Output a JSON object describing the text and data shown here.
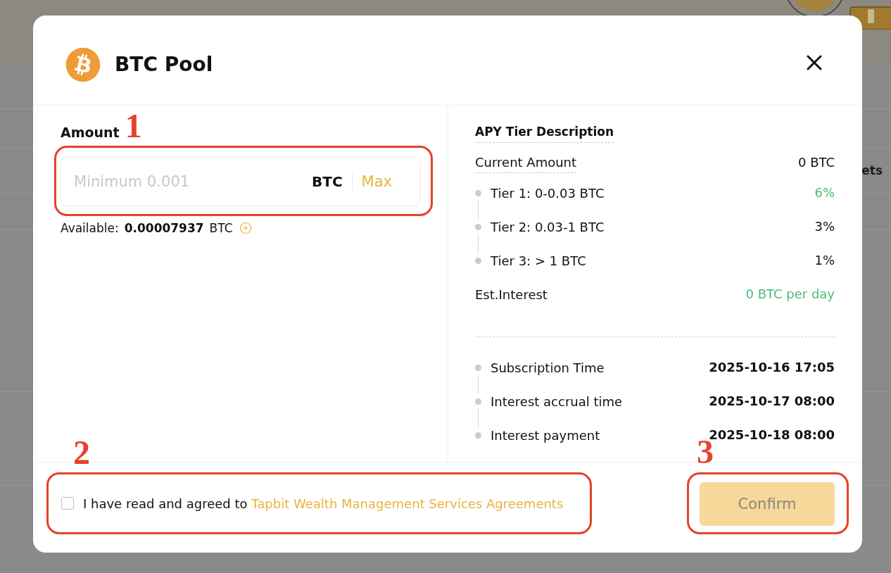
{
  "background_page": {
    "partial_text": "ets"
  },
  "dialog": {
    "title": "BTC Pool",
    "amount": {
      "label": "Amount",
      "annotation": "1",
      "placeholder": "Minimum 0.001",
      "unit": "BTC",
      "max_button": "Max",
      "available_label": "Available:",
      "available_value": "0.00007937",
      "available_unit": "BTC"
    },
    "apy": {
      "heading": "APY Tier Description",
      "current_amount_label": "Current Amount",
      "current_amount_value": "0 BTC",
      "tiers": [
        {
          "label": "Tier 1: 0-0.03 BTC",
          "rate": "6%",
          "current": true
        },
        {
          "label": "Tier 2: 0.03-1 BTC",
          "rate": "3%",
          "current": false
        },
        {
          "label": "Tier 3: > 1 BTC",
          "rate": "1%",
          "current": false
        }
      ],
      "estimate_label": "Est.Interest",
      "estimate_value": "0 BTC per day"
    },
    "schedule": [
      {
        "label": "Subscription Time",
        "value": "2025-10-16 17:05"
      },
      {
        "label": "Interest accrual time",
        "value": "2025-10-17 08:00"
      },
      {
        "label": "Interest payment",
        "value": "2025-10-18 08:00"
      }
    ],
    "agreement": {
      "annotation": "2",
      "checked": false,
      "text": "I have read and agreed to",
      "link": "Tapbit Wealth Management Services Agreements"
    },
    "confirm_button": {
      "annotation": "3",
      "label": "Confirm",
      "disabled": true
    }
  }
}
